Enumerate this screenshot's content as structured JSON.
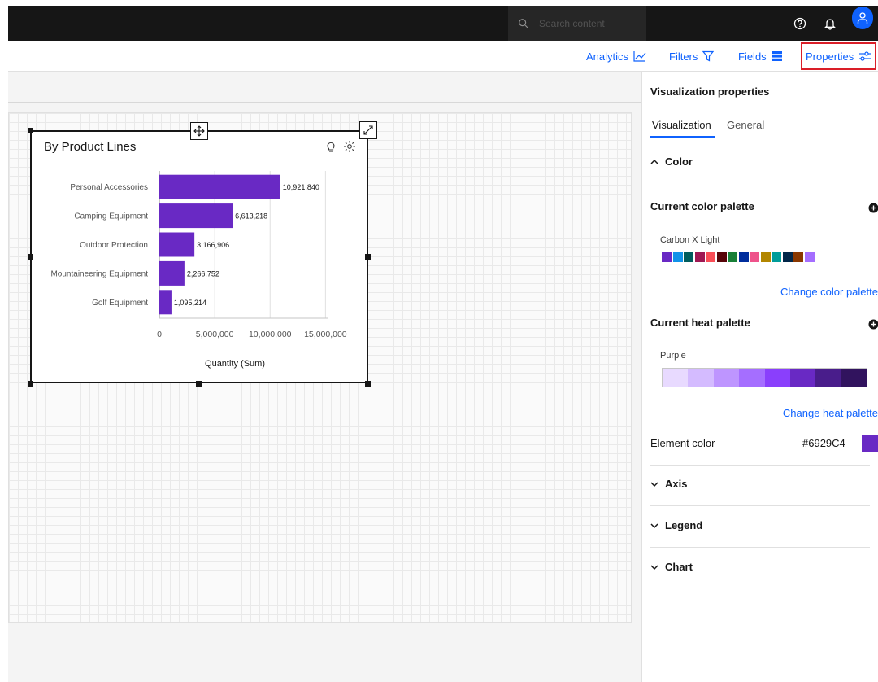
{
  "header": {
    "search_placeholder": "Search content"
  },
  "toolbar": {
    "analytics_label": "Analytics",
    "filters_label": "Filters",
    "fields_label": "Fields",
    "properties_label": "Properties"
  },
  "widget": {
    "title": "By Product Lines"
  },
  "chart_data": {
    "type": "bar",
    "orientation": "horizontal",
    "categories": [
      "Personal Accessories",
      "Camping Equipment",
      "Outdoor Protection",
      "Mountaineering Equipment",
      "Golf Equipment"
    ],
    "values": [
      10921840,
      6613218,
      3166906,
      2266752,
      1095214
    ],
    "value_labels": [
      "10,921,840",
      "6,613,218",
      "3,166,906",
      "2,266,752",
      "1,095,214"
    ],
    "xlabel": "Quantity (Sum)",
    "ylabel": "",
    "xlim": [
      0,
      16000000
    ],
    "x_ticks": [
      "0",
      "5,000,000",
      "10,000,000",
      "15,000,000"
    ],
    "x_tick_values": [
      0,
      5000000,
      10000000,
      15000000
    ],
    "bar_color": "#6929C4",
    "grid": "vertical"
  },
  "panel": {
    "title": "Visualization properties",
    "tabs": [
      "Visualization",
      "General"
    ],
    "color_section": "Color",
    "current_color_palette": "Current color palette",
    "palette_name": "Carbon X Light",
    "palette_colors": [
      "#6929c4",
      "#1192e8",
      "#005d5d",
      "#9f1853",
      "#fa4d56",
      "#570408",
      "#198038",
      "#002d9c",
      "#ee538b",
      "#b28600",
      "#009d9a",
      "#012749",
      "#8a3800",
      "#a56eff"
    ],
    "change_color_palette": "Change color palette",
    "current_heat_palette": "Current heat palette",
    "heat_name": "Purple",
    "heat_colors": [
      "#e8daff",
      "#d4bbff",
      "#be95ff",
      "#a56eff",
      "#8a3ffc",
      "#6929c4",
      "#491d8b",
      "#31135e"
    ],
    "change_heat_palette": "Change heat palette",
    "element_color_label": "Element color",
    "element_color_value": "#6929C4",
    "axis_section": "Axis",
    "legend_section": "Legend",
    "chart_section": "Chart"
  }
}
